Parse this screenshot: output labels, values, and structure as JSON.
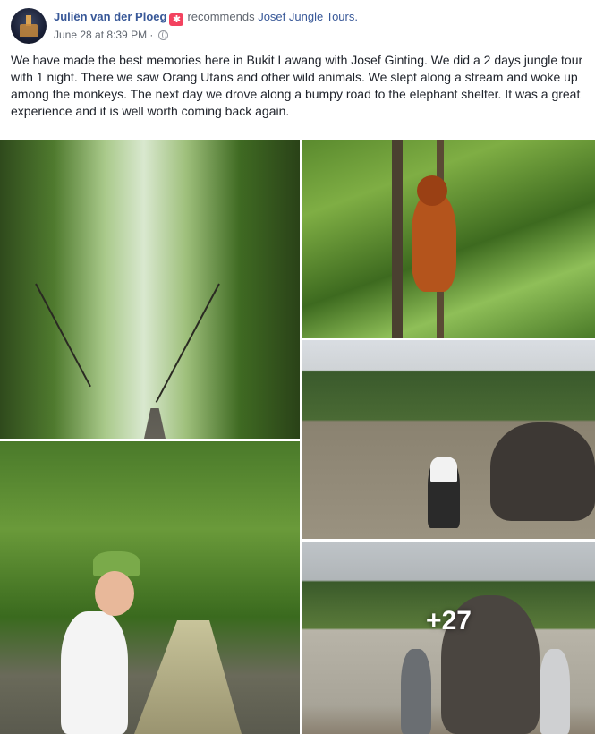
{
  "post": {
    "author": "Juliën van der Ploeg",
    "action": "recommends",
    "page": "Josef Jungle Tours.",
    "timestamp": "June 28 at 8:39 PM",
    "separator": "·",
    "privacy_icon": "globe-icon",
    "text": "We have made the best memories here in Bukit Lawang with Josef Ginting. We did a 2 days jungle tour with 1 night. There we saw Orang Utans and other wild animals. We slept along a stream and woke up among the monkeys. The next day we drove along a bumpy road to the elephant shelter. It was a great experience and it is well worth coming back again."
  },
  "photos": {
    "more_count": "+27"
  },
  "colors": {
    "link": "#385898",
    "recommend_badge": "#f3425f",
    "meta_text": "#616770"
  }
}
